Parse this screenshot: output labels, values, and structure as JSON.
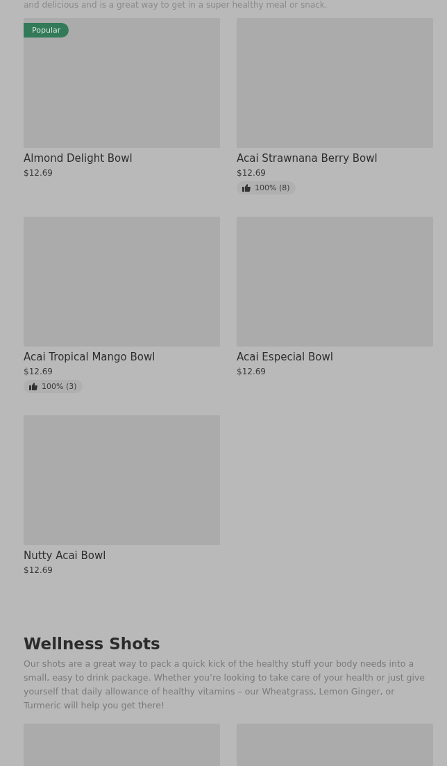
{
  "intro_text": "and delicious and is a great way to get in a super healthy meal or snack.",
  "bowls": [
    {
      "name": "Almond Delight Bowl",
      "price": "$12.69",
      "badge": "Popular"
    },
    {
      "name": "Acai Strawnana Berry Bowl",
      "price": "$12.69",
      "rating": "100% (8)"
    },
    {
      "name": "Acai Tropical Mango Bowl",
      "price": "$12.69",
      "rating": "100% (3)"
    },
    {
      "name": "Acai Especial Bowl",
      "price": "$12.69"
    },
    {
      "name": "Nutty Acai Bowl",
      "price": "$12.69"
    }
  ],
  "wellness_section": {
    "title": "Wellness Shots",
    "description": "Our shots are a great way to pack a quick kick of the healthy stuff your body needs into a small, easy to drink package. Whether you’re looking to take care of your health or just give yourself that daily allowance of healthy vitamins – our Wheatgrass, Lemon Ginger, or Turmeric will help you get there!"
  }
}
